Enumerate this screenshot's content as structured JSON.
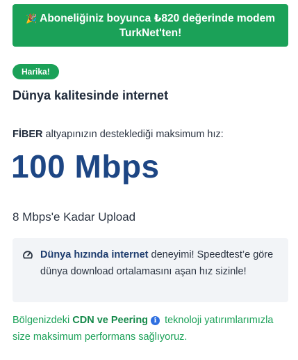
{
  "banner": {
    "emoji": "🎉",
    "text": "Aboneliğiniz boyunca ₺820 değerinde modem TurkNet'ten!"
  },
  "badge": {
    "label": "Harika!"
  },
  "title": "Dünya kalitesinde internet",
  "tech": {
    "type": "FİBER",
    "rest": " altyapınızın desteklediği maksimum hız:"
  },
  "speed": "100 Mbps",
  "upload": "8 Mbps'e Kadar Upload",
  "info_box": {
    "icon": "gauge-icon",
    "bold": "Dünya hızında internet",
    "rest": " deneyimi! Speedtest’e göre dünya download ortalamasını aşan hız sizinle!"
  },
  "cdn": {
    "prefix": "Bölgenizdeki ",
    "bold": "CDN ve Peering",
    "info_icon_glyph": "i",
    "suffix": " teknoloji yatırımlarımızla size maksimum performans sağlıyoruz."
  },
  "colors": {
    "brand_green": "#1ba158",
    "speed_blue": "#1d4684",
    "info_blue": "#2f6fe0",
    "info_bg": "#f2f4f7"
  }
}
